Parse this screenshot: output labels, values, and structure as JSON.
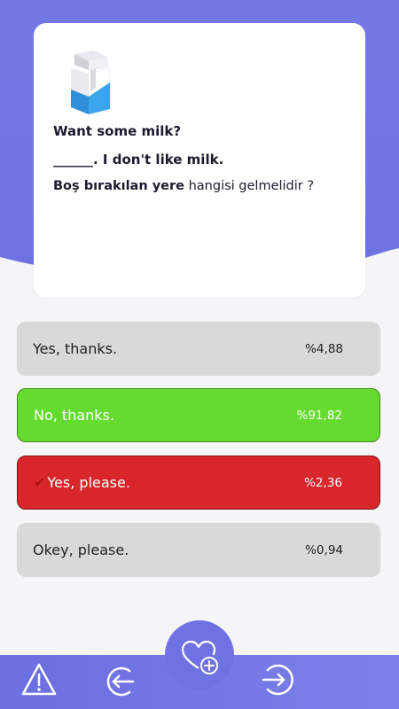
{
  "question": {
    "icon": "milk-carton-icon",
    "line1": "Want some milk?",
    "line2": "______. I don't like milk.",
    "prompt_bold": "Boş bırakılan yere",
    "prompt_rest": " hangisi gelmelidir ?"
  },
  "options": [
    {
      "label": "Yes, thanks.",
      "percent": "%4,88",
      "state": "neutral"
    },
    {
      "label": "No, thanks.",
      "percent": "%91,82",
      "state": "correct"
    },
    {
      "label": "Yes, please.",
      "percent": "%2,36",
      "state": "wrong-selected"
    },
    {
      "label": "Okey, please.",
      "percent": "%0,94",
      "state": "neutral"
    }
  ],
  "bottom_nav": {
    "items": [
      "warning-icon",
      "back-arrow-icon",
      "heart-add-icon",
      "exit-arrow-icon"
    ]
  },
  "colors": {
    "accent": "#6f73e1",
    "correct": "#65db2f",
    "wrong": "#d8262a",
    "neutral": "#d9d9d9"
  }
}
